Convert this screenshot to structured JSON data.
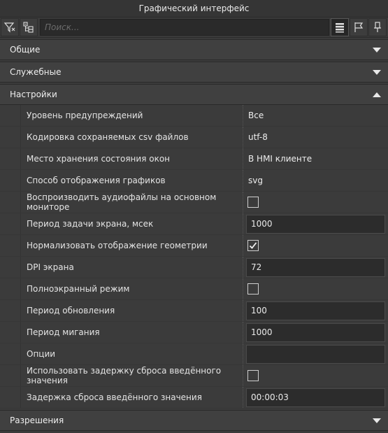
{
  "window": {
    "title": "Графический интерфейс"
  },
  "toolbar": {
    "search_placeholder": "Поиск...",
    "filter_icon": "filter-icon",
    "collapse_icon": "collapse-tree-icon",
    "list_icon": "list-view-icon",
    "flag_icon": "flag-icon",
    "pin_icon": "pin-icon"
  },
  "sections": {
    "general": {
      "label": "Общие",
      "expanded": false
    },
    "service": {
      "label": "Служебные",
      "expanded": false
    },
    "settings": {
      "label": "Настройки",
      "expanded": true
    },
    "permissions": {
      "label": "Разрешения",
      "expanded": false
    }
  },
  "settings": {
    "rows": [
      {
        "label": "Уровень предупреждений",
        "type": "text",
        "value": "Все"
      },
      {
        "label": "Кодировка сохраняемых csv файлов",
        "type": "text",
        "value": "utf-8"
      },
      {
        "label": "Место хранения состояния окон",
        "type": "text",
        "value": "В HMI клиенте"
      },
      {
        "label": "Способ отображения графиков",
        "type": "text",
        "value": "svg"
      },
      {
        "label": "Воспроизводить аудиофайлы на основном мониторе",
        "type": "checkbox",
        "checked": false
      },
      {
        "label": "Период задачи экрана, мсек",
        "type": "field",
        "value": "1000"
      },
      {
        "label": "Нормализовать отображение геометрии",
        "type": "checkbox",
        "checked": true
      },
      {
        "label": "DPI экрана",
        "type": "field",
        "value": "72"
      },
      {
        "label": "Полноэкранный режим",
        "type": "checkbox",
        "checked": false
      },
      {
        "label": "Период обновления",
        "type": "field",
        "value": "100"
      },
      {
        "label": "Период мигания",
        "type": "field",
        "value": "1000"
      },
      {
        "label": "Опции",
        "type": "field",
        "value": ""
      },
      {
        "label": "Использовать задержку сброса введённого значения",
        "type": "checkbox",
        "checked": false
      },
      {
        "label": "Задержка сброса введённого значения",
        "type": "field",
        "value": "00:00:03"
      }
    ]
  },
  "colors": {
    "background": "#3b3b3b",
    "header": "#404040",
    "field": "#2c2c2c",
    "text": "#e6e6e6"
  }
}
